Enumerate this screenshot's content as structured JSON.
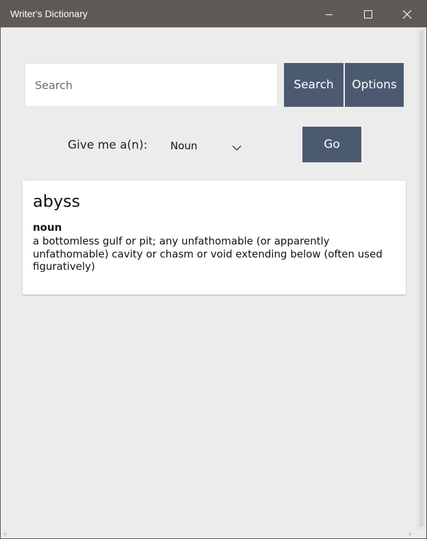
{
  "window": {
    "title": "Writer's Dictionary",
    "colors": {
      "titlebar": "#5f5a55",
      "accent": "#4c5a70",
      "background": "#ececec"
    },
    "controls": {
      "minimize_icon": "minimize-icon",
      "maximize_icon": "maximize-icon",
      "close_icon": "close-icon"
    }
  },
  "search": {
    "placeholder": "Search",
    "value": "",
    "search_label": "Search",
    "options_label": "Options"
  },
  "random": {
    "label": "Give me a(n):",
    "selected": "Noun",
    "go_label": "Go"
  },
  "result": {
    "word": "abyss",
    "part_of_speech": "noun",
    "definition": "a bottomless gulf or pit; any unfathomable (or apparently unfathomable) cavity or chasm or void extending below (often used figuratively)"
  },
  "scrollbars": {
    "left_arrow": "‹",
    "right_arrow": "›"
  }
}
